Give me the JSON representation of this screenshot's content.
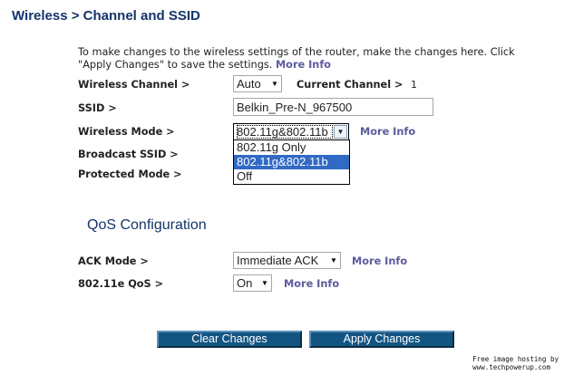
{
  "page_title": "Wireless > Channel and SSID",
  "intro": {
    "text": "To make changes to the wireless settings of the router, make the changes here. Click \"Apply Changes\" to save the settings.",
    "more_info": "More Info"
  },
  "wireless_channel": {
    "label": "Wireless Channel >",
    "value": "Auto",
    "current_label": "Current Channel >",
    "current_value": "1"
  },
  "ssid": {
    "label": "SSID >",
    "value": "Belkin_Pre-N_967500"
  },
  "wireless_mode": {
    "label": "Wireless Mode >",
    "value": "802.11g&802.11b",
    "more_info": "More Info",
    "options": [
      "802.11g Only",
      "802.11g&802.11b",
      "Off"
    ],
    "highlighted_option": "802.11g&802.11b"
  },
  "broadcast_ssid": {
    "label": "Broadcast SSID >"
  },
  "protected_mode": {
    "label": "Protected Mode >"
  },
  "qos": {
    "heading": "QoS Configuration",
    "ack_mode": {
      "label": "ACK Mode >",
      "value": "Immediate ACK",
      "more_info": "More Info"
    },
    "wmm": {
      "label": "802.11e QoS >",
      "value": "On",
      "more_info": "More Info"
    }
  },
  "buttons": {
    "clear": "Clear Changes",
    "apply": "Apply Changes"
  },
  "watermark": {
    "line1": "Free image hosting by",
    "line2": "www.techpowerup.com"
  },
  "colors": {
    "heading": "#13346b",
    "more_info": "#5b5b9e",
    "button_bg": "#135582",
    "selection": "#316ac5"
  }
}
